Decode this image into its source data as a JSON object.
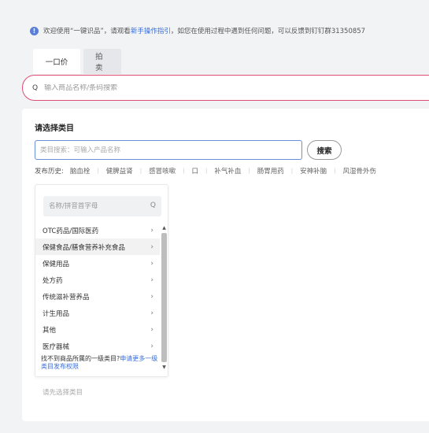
{
  "notice": {
    "prefix": "欢迎使用“一键识品”，请观看",
    "link": "新手操作指引",
    "suffix": "，如您在使用过程中遇到任何问题，可以反馈到钉钉群31350857"
  },
  "tabs": [
    {
      "label": "一口价",
      "active": true
    },
    {
      "label": "拍卖",
      "active": false
    }
  ],
  "main_search": {
    "placeholder": "输入商品名称/条码搜索"
  },
  "category": {
    "title": "请选择类目",
    "search_placeholder": "类目搜索：可输入产品名称",
    "search_button": "搜索",
    "history_label": "发布历史:",
    "history": [
      "脑血栓",
      "健脾益肾",
      "感冒咳嗽",
      "口",
      "补气补血",
      "肠胃用药",
      "安神补脑",
      "风湿骨外伤"
    ],
    "dropdown": {
      "search_placeholder": "名称/拼音首字母",
      "items": [
        {
          "label": "OTC药品/国际医药",
          "selected": false
        },
        {
          "label": "保健食品/膳食营养补充食品",
          "selected": true
        },
        {
          "label": "保健用品",
          "selected": false
        },
        {
          "label": "处方药",
          "selected": false
        },
        {
          "label": "传统滋补营养品",
          "selected": false
        },
        {
          "label": "计生用品",
          "selected": false
        },
        {
          "label": "其他",
          "selected": false
        },
        {
          "label": "医疗器械",
          "selected": false
        }
      ],
      "footer_text": "找不到商品所属的一级类目?",
      "footer_link": "申请更多一级类目发布权限"
    },
    "choose_first": "请先选择类目"
  },
  "colors": {
    "accent_border": "#e04d74",
    "link": "#3a6ed8",
    "focus_border": "#6a8fd8"
  },
  "icons": {
    "info": "info-circle-icon",
    "search": "search-icon",
    "chevron": "chevron-right-icon"
  }
}
